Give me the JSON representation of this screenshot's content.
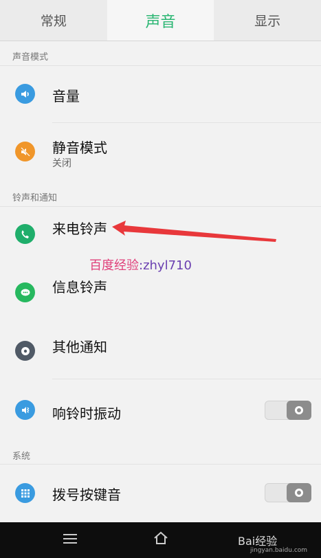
{
  "tabs": [
    {
      "label": "常规",
      "active": false
    },
    {
      "label": "声音",
      "active": true
    },
    {
      "label": "显示",
      "active": false
    }
  ],
  "sections": {
    "sound_mode": "声音模式",
    "ringtone": "铃声和通知",
    "system": "系统"
  },
  "items": {
    "volume": {
      "title": "音量",
      "icon": "speaker-icon",
      "color": "#3a9be0"
    },
    "silent": {
      "title": "静音模式",
      "subtitle": "关闭",
      "icon": "mute-icon",
      "color": "#f0962a"
    },
    "ringtone": {
      "title": "来电铃声",
      "icon": "phone-icon",
      "color": "#1fae6b"
    },
    "message": {
      "title": "信息铃声",
      "icon": "message-icon",
      "color": "#27b85f"
    },
    "other": {
      "title": "其他通知",
      "icon": "disc-icon",
      "color": "#505a66"
    },
    "vibrate": {
      "title": "响铃时振动",
      "icon": "vibrate-icon",
      "color": "#3a9be0",
      "toggle": "off"
    },
    "dialpad": {
      "title": "拨号按键音",
      "icon": "dialpad-icon",
      "color": "#3a9be0",
      "toggle": "off"
    }
  },
  "annotation": {
    "arrow_color": "#e8383b",
    "watermark_a": "百度经验",
    "watermark_b": ":zhyl710"
  },
  "bottom_nav": {
    "brand": "Bai经验",
    "brand_sub": "jingyan.baidu.com"
  }
}
